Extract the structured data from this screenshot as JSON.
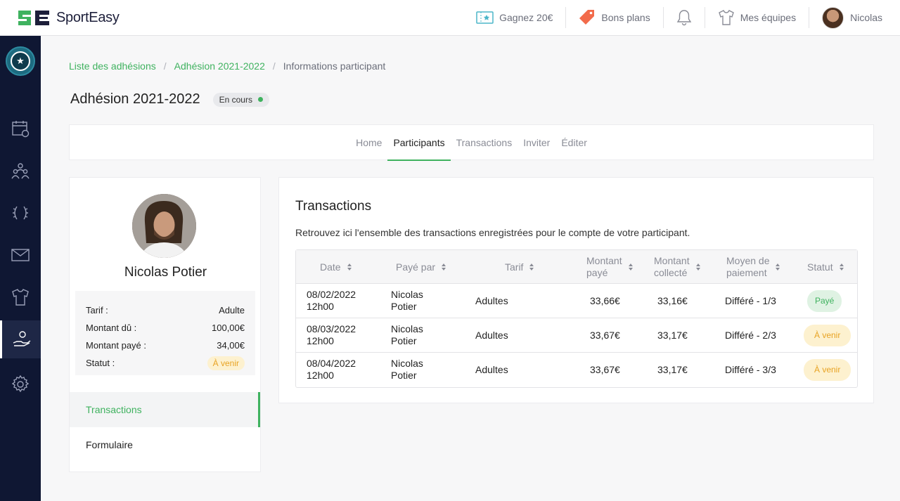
{
  "app": {
    "name": "SportEasy"
  },
  "topbar": {
    "earn_label": "Gagnez 20€",
    "deals_label": "Bons plans",
    "teams_label": "Mes équipes",
    "user_name": "Nicolas"
  },
  "sidebar": {
    "items": [
      "calendar-icon",
      "members-icon",
      "laurel-icon",
      "mail-icon",
      "jersey-icon",
      "membership-icon",
      "settings-icon"
    ],
    "active": "membership-icon"
  },
  "breadcrumb": {
    "items": [
      "Liste des adhésions",
      "Adhésion 2021-2022"
    ],
    "current": "Informations participant"
  },
  "page": {
    "title": "Adhésion 2021-2022",
    "status": "En cours"
  },
  "tabs": [
    "Home",
    "Participants",
    "Transactions",
    "Inviter",
    "Éditer"
  ],
  "active_tab": "Participants",
  "participant": {
    "name": "Nicolas Potier",
    "info": [
      {
        "label": "Tarif :",
        "value": "Adulte"
      },
      {
        "label": "Montant dû :",
        "value": "100,00€"
      },
      {
        "label": "Montant payé :",
        "value": "34,00€"
      },
      {
        "label": "Statut :",
        "value": "À venir"
      }
    ],
    "menu": [
      "Transactions",
      "Formulaire"
    ]
  },
  "transactions": {
    "title": "Transactions",
    "description": "Retrouvez ici l'ensemble des transactions enregistrées pour le compte de votre participant.",
    "columns": [
      {
        "line1": "Date",
        "line2": ""
      },
      {
        "line1": "Payé par",
        "line2": ""
      },
      {
        "line1": "Tarif",
        "line2": ""
      },
      {
        "line1": "Montant",
        "line2": "payé"
      },
      {
        "line1": "Montant",
        "line2": "collecté"
      },
      {
        "line1": "Moyen de",
        "line2": "paiement"
      },
      {
        "line1": "Statut",
        "line2": ""
      }
    ],
    "rows": [
      {
        "date": "08/02/2022",
        "time": "12h00",
        "payer_first": "Nicolas",
        "payer_last": "Potier",
        "tarif": "Adultes",
        "paid": "33,66€",
        "collected": "33,16€",
        "method": "Différé - 1/3",
        "status": "Payé"
      },
      {
        "date": "08/03/2022",
        "time": "12h00",
        "payer_first": "Nicolas",
        "payer_last": "Potier",
        "tarif": "Adultes",
        "paid": "33,67€",
        "collected": "33,17€",
        "method": "Différé - 2/3",
        "status": "À venir"
      },
      {
        "date": "08/04/2022",
        "time": "12h00",
        "payer_first": "Nicolas",
        "payer_last": "Potier",
        "tarif": "Adultes",
        "paid": "33,67€",
        "collected": "33,17€",
        "method": "Différé - 3/3",
        "status": "À venir"
      }
    ]
  },
  "colors": {
    "accent": "#3fb25f",
    "sidebar": "#0f1733",
    "upcoming": "#e8a323"
  }
}
